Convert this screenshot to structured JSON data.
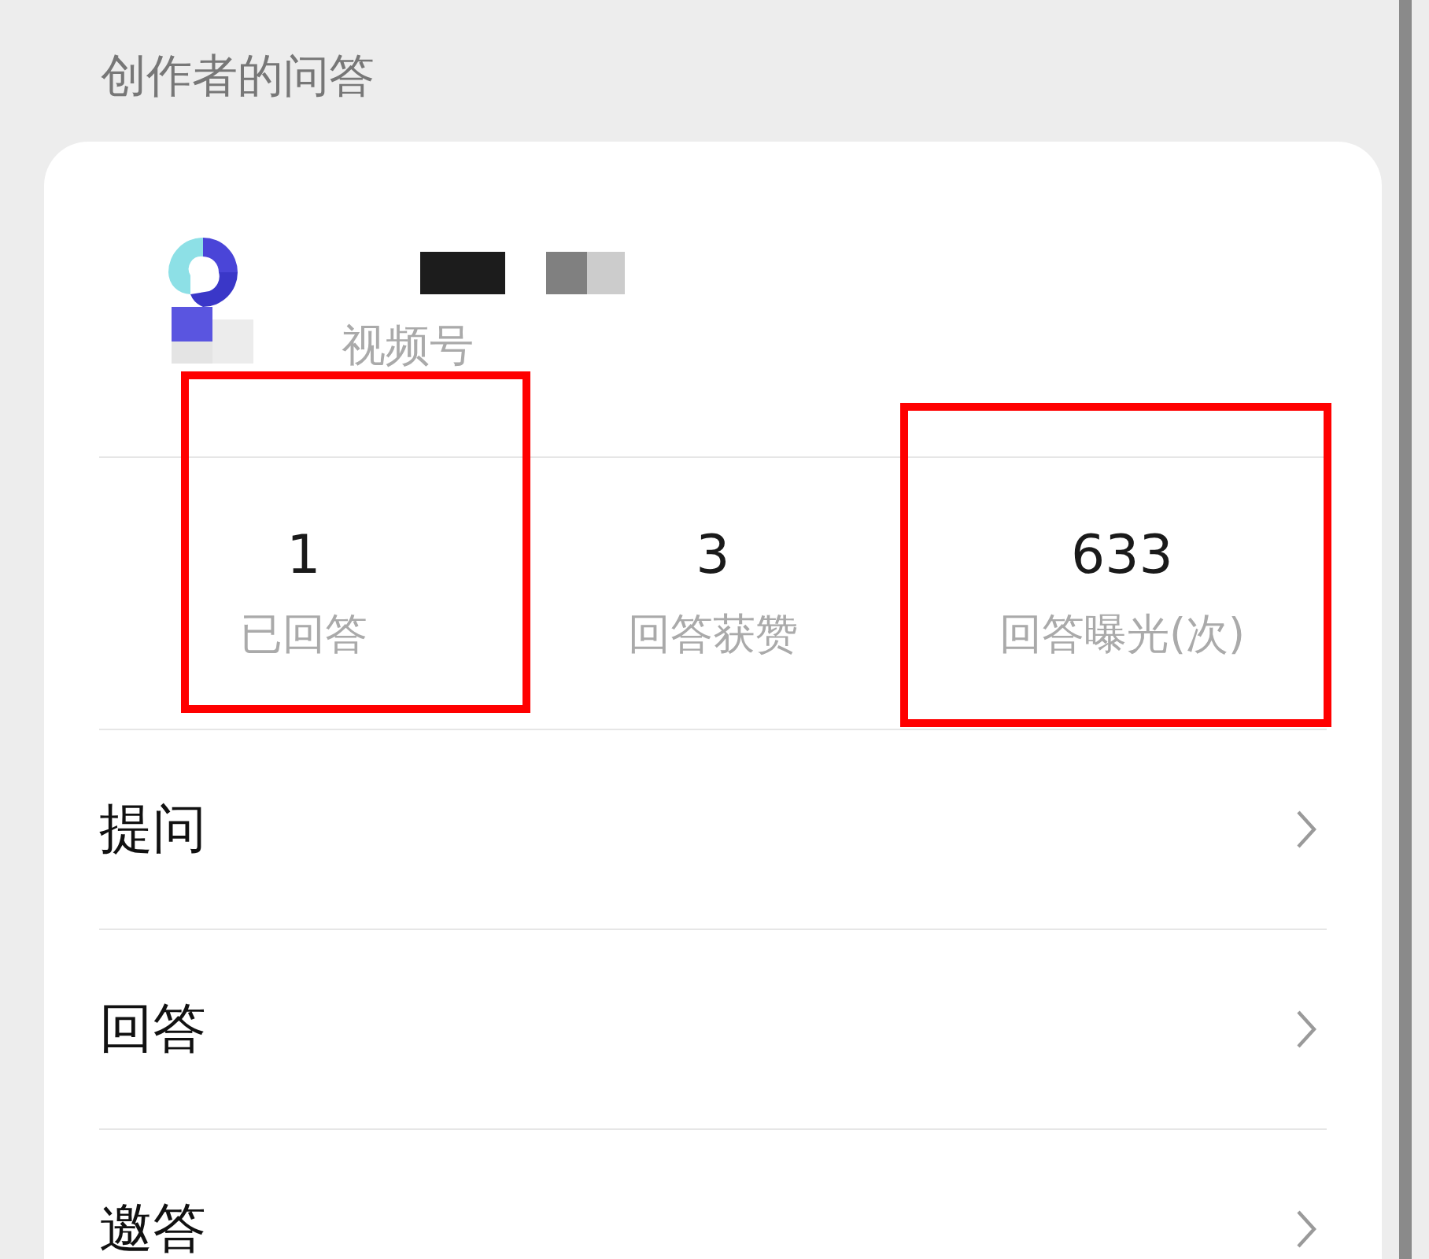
{
  "section_title": "创作者的问答",
  "profile": {
    "subtitle": "视频号"
  },
  "stats": [
    {
      "value": "1",
      "label": "已回答",
      "highlighted": true
    },
    {
      "value": "3",
      "label": "回答获赞",
      "highlighted": false
    },
    {
      "value": "633",
      "label": "回答曝光(次)",
      "highlighted": true
    }
  ],
  "menu": [
    {
      "label": "提问"
    },
    {
      "label": "回答"
    },
    {
      "label": "邀答"
    }
  ]
}
